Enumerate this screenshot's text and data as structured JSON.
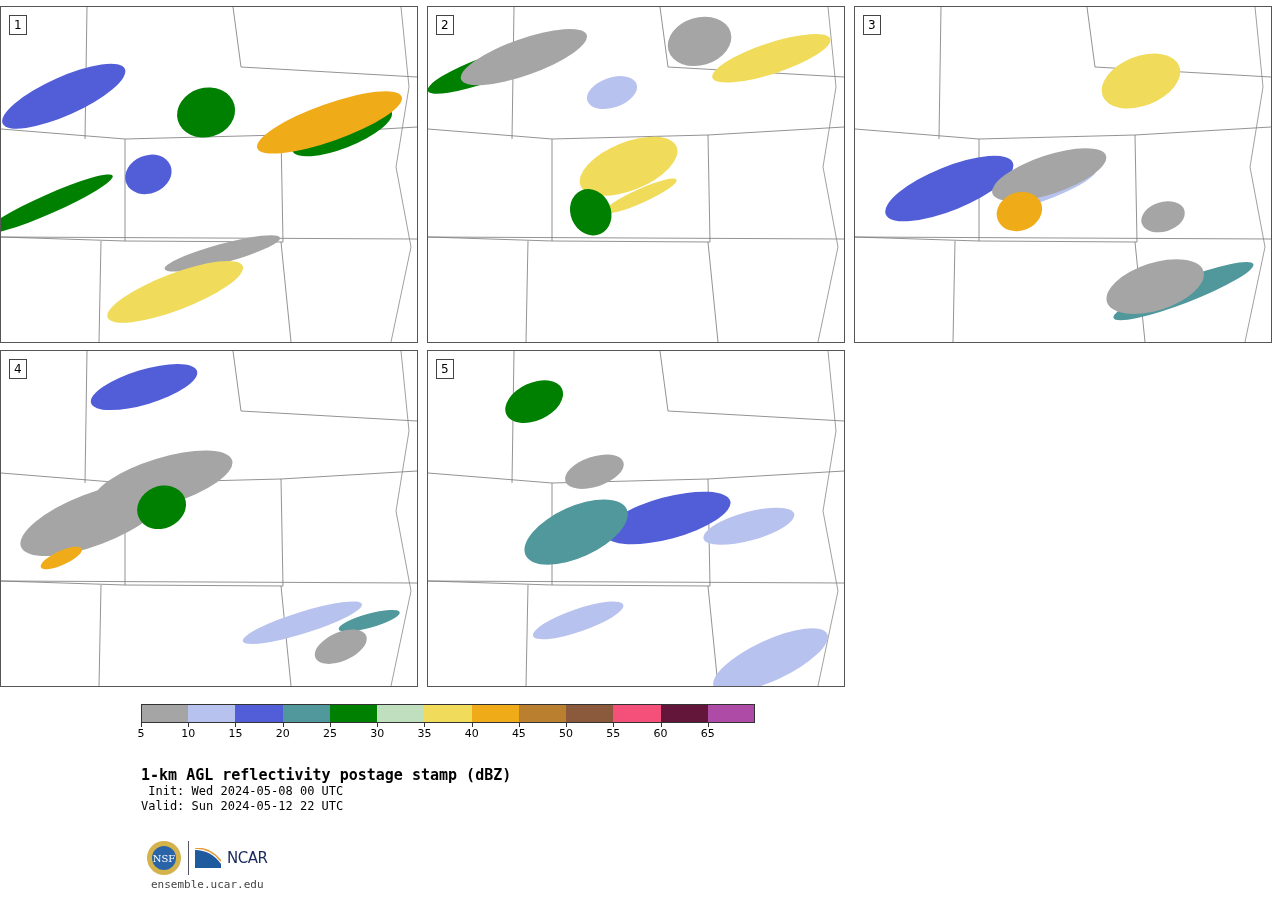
{
  "panels": [
    {
      "label": "1"
    },
    {
      "label": "2"
    },
    {
      "label": "3"
    },
    {
      "label": "4"
    },
    {
      "label": "5"
    }
  ],
  "colorbar": [
    {
      "label": "5",
      "color": "#a5a5a5"
    },
    {
      "label": "10",
      "color": "#b8c2ee"
    },
    {
      "label": "15",
      "color": "#525ed8"
    },
    {
      "label": "20",
      "color": "#50989c"
    },
    {
      "label": "25",
      "color": "#008000"
    },
    {
      "label": "30",
      "color": "#bfdfbf"
    },
    {
      "label": "35",
      "color": "#f0dc5a"
    },
    {
      "label": "40",
      "color": "#f0ab18"
    },
    {
      "label": "45",
      "color": "#ba8030"
    },
    {
      "label": "50",
      "color": "#8b5a3c"
    },
    {
      "label": "55",
      "color": "#f5507a"
    },
    {
      "label": "60",
      "color": "#64163a"
    },
    {
      "label": "65",
      "color": "#ae4ba6"
    }
  ],
  "title": "1-km AGL reflectivity postage stamp (dBZ)",
  "init": " Init: Wed 2024-05-08 00 UTC",
  "valid": "Valid: Sun 2024-05-12 22 UTC",
  "logos": {
    "left": "NSF",
    "right": "NCAR"
  },
  "url": "ensemble.ucar.edu"
}
